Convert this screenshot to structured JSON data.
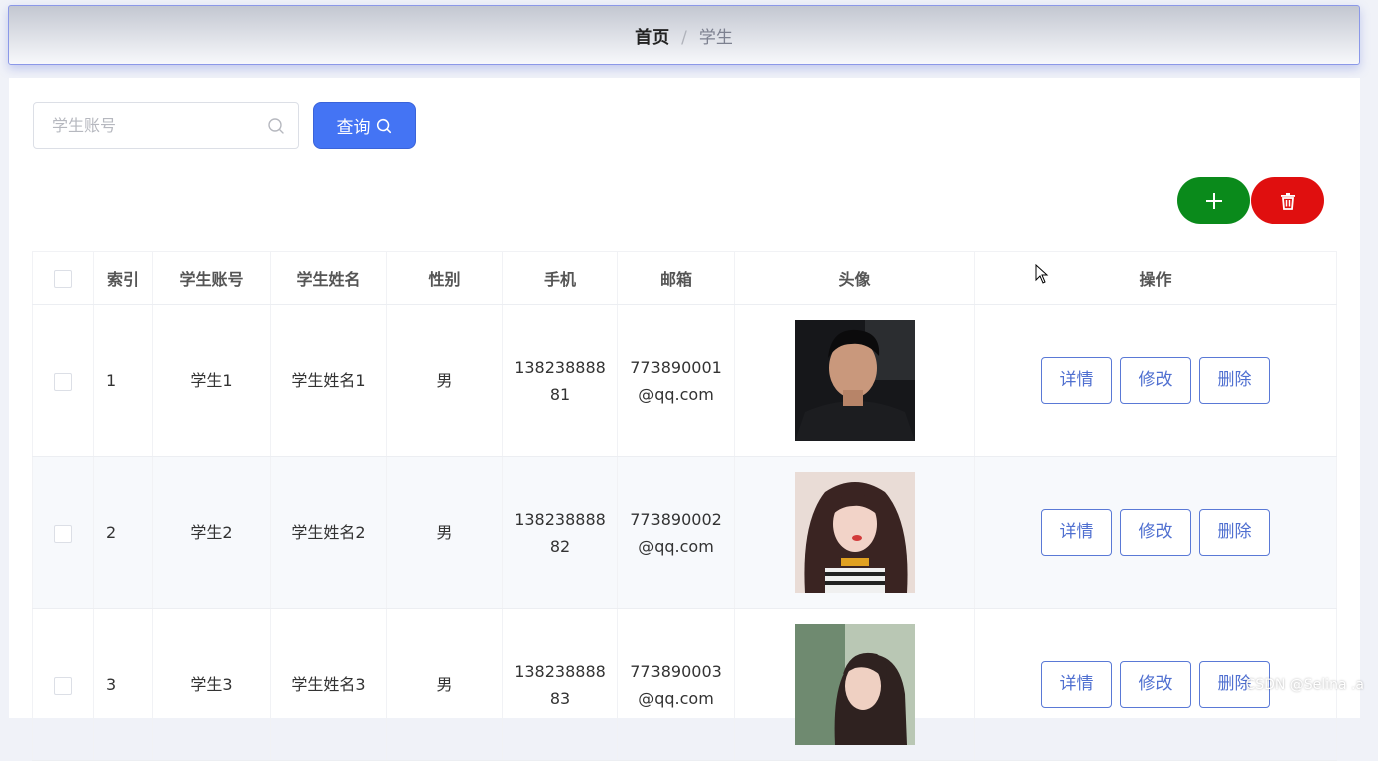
{
  "breadcrumb": {
    "home": "首页",
    "separator": "/",
    "current": "学生"
  },
  "search": {
    "placeholder": "学生账号",
    "value": "",
    "button_label": "查询"
  },
  "actions": {
    "add_icon": "plus-icon",
    "delete_icon": "trash-icon"
  },
  "colors": {
    "primary": "#4474f4",
    "add": "#0a8a1b",
    "delete": "#e00f0f",
    "link": "#4f6fd0"
  },
  "table": {
    "headers": [
      "索引",
      "学生账号",
      "学生姓名",
      "性别",
      "手机",
      "邮箱",
      "头像",
      "操作"
    ],
    "rows": [
      {
        "index": "1",
        "account": "学生1",
        "name": "学生姓名1",
        "gender": "男",
        "phone_line1": "138238888",
        "phone_line2": "81",
        "email_line1": "773890001",
        "email_line2": "@qq.com"
      },
      {
        "index": "2",
        "account": "学生2",
        "name": "学生姓名2",
        "gender": "男",
        "phone_line1": "138238888",
        "phone_line2": "82",
        "email_line1": "773890002",
        "email_line2": "@qq.com"
      },
      {
        "index": "3",
        "account": "学生3",
        "name": "学生姓名3",
        "gender": "男",
        "phone_line1": "138238888",
        "phone_line2": "83",
        "email_line1": "773890003",
        "email_line2": "@qq.com"
      }
    ],
    "op_labels": {
      "detail": "详情",
      "edit": "修改",
      "delete": "删除"
    }
  },
  "watermark": "CSDN @Selina .a"
}
